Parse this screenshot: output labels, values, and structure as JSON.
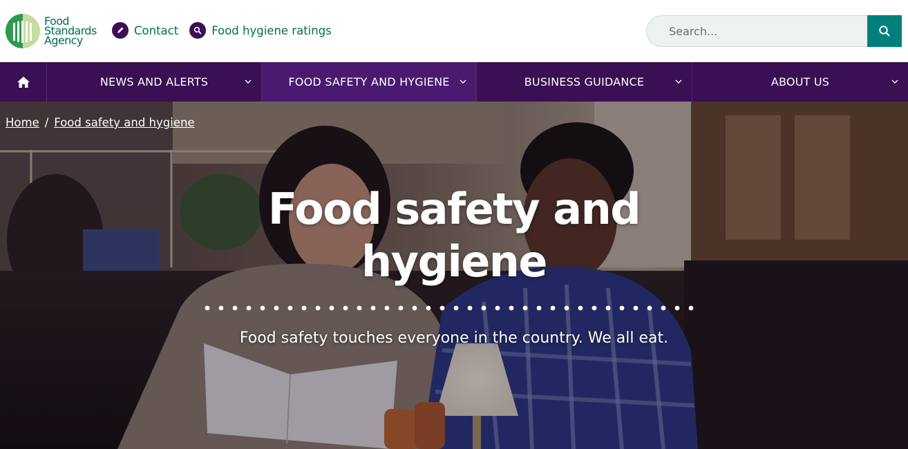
{
  "header": {
    "logo": {
      "line1": "Food",
      "line2": "Standards",
      "line3": "Agency"
    },
    "utility_links": [
      {
        "label": "Contact",
        "icon": "pencil-icon"
      },
      {
        "label": "Food hygiene ratings",
        "icon": "search-icon"
      }
    ],
    "search": {
      "placeholder": "Search...",
      "button_icon": "search-icon"
    }
  },
  "nav": {
    "home_icon": "home-icon",
    "items": [
      {
        "label": "NEWS AND ALERTS",
        "active": false
      },
      {
        "label": "FOOD SAFETY AND HYGIENE",
        "active": true
      },
      {
        "label": "BUSINESS GUIDANCE",
        "active": false
      },
      {
        "label": "ABOUT US",
        "active": false
      }
    ]
  },
  "hero": {
    "breadcrumb": [
      {
        "label": "Home"
      },
      {
        "label": "Food safety and hygiene"
      }
    ],
    "breadcrumb_separator": "/",
    "title_line1": "Food safety and",
    "title_line2": "hygiene",
    "subtitle": "Food safety touches everyone in the country. We all eat."
  },
  "colors": {
    "brand_green": "#006f51",
    "nav_purple": "#3a0f54",
    "nav_active": "#4a1a70",
    "search_teal": "#00807a"
  }
}
